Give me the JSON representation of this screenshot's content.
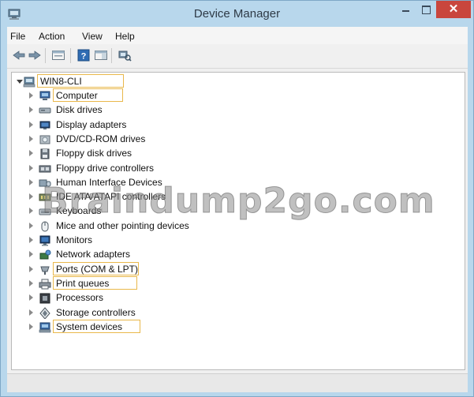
{
  "window": {
    "title": "Device Manager",
    "close_glyph": "✕",
    "colors": {
      "frame": "#b8d7ec",
      "close": "#c9463d",
      "highlight_box": "#e9b84b"
    }
  },
  "menu": [
    "File",
    "Action",
    "View",
    "Help"
  ],
  "toolbar": {
    "buttons": [
      "back-arrow-icon",
      "forward-arrow-icon",
      "properties-pane-icon",
      "help-icon",
      "details-pane-icon",
      "scan-hardware-icon"
    ]
  },
  "tree": {
    "root": {
      "label": "WIN8-CLI",
      "icon": "computer-root-icon",
      "expanded": true,
      "highlighted": true
    },
    "items": [
      {
        "label": "Computer",
        "icon": "computer-icon",
        "highlighted": true
      },
      {
        "label": "Disk drives",
        "icon": "disk-drive-icon",
        "highlighted": false
      },
      {
        "label": "Display adapters",
        "icon": "display-adapter-icon",
        "highlighted": false
      },
      {
        "label": "DVD/CD-ROM drives",
        "icon": "dvd-drive-icon",
        "highlighted": false
      },
      {
        "label": "Floppy disk drives",
        "icon": "floppy-disk-icon",
        "highlighted": false
      },
      {
        "label": "Floppy drive controllers",
        "icon": "floppy-controller-icon",
        "highlighted": false
      },
      {
        "label": "Human Interface Devices",
        "icon": "hid-icon",
        "highlighted": false
      },
      {
        "label": "IDE ATA/ATAPI controllers",
        "icon": "ide-controller-icon",
        "highlighted": false
      },
      {
        "label": "Keyboards",
        "icon": "keyboard-icon",
        "highlighted": false
      },
      {
        "label": "Mice and other pointing devices",
        "icon": "mouse-icon",
        "highlighted": false
      },
      {
        "label": "Monitors",
        "icon": "monitor-icon",
        "highlighted": false
      },
      {
        "label": "Network adapters",
        "icon": "network-adapter-icon",
        "highlighted": false
      },
      {
        "label": "Ports (COM & LPT)",
        "icon": "port-icon",
        "highlighted": true
      },
      {
        "label": "Print queues",
        "icon": "printer-icon",
        "highlighted": true
      },
      {
        "label": "Processors",
        "icon": "processor-icon",
        "highlighted": false
      },
      {
        "label": "Storage controllers",
        "icon": "storage-controller-icon",
        "highlighted": false
      },
      {
        "label": "System devices",
        "icon": "system-devices-icon",
        "highlighted": true
      }
    ]
  },
  "watermark": "Braindump2go.com"
}
